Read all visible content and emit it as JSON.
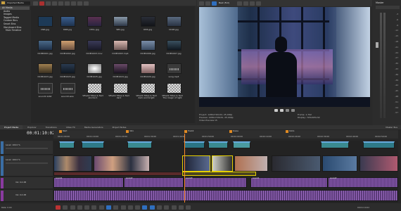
{
  "explorer": {
    "path": "Imported Media",
    "tree": [
      "All Media",
      "Audio",
      "Images",
      "Tagged Media",
      "Custom Bins",
      "Smart Bins",
      "Storyboard Bins",
      "Main Timeline"
    ],
    "row1": [
      {
        "label": "CNR.jpg",
        "color": "#1d3a57"
      },
      {
        "label": "DRB.jpg",
        "color": "#253c5e"
      },
      {
        "label": "DTCL.jpg",
        "color": "#3d3048"
      },
      {
        "label": "SBS.jpg",
        "color": "#4a5565"
      },
      {
        "label": "OMS.jpg",
        "color": "#222630"
      },
      {
        "label": "DCIM.jpg",
        "color": "#3b4759"
      }
    ],
    "row2": [
      {
        "label": "DCIM0001.jpg",
        "color": "#2f4a69"
      },
      {
        "label": "DCIM1002.jpg",
        "color": "#a38060"
      },
      {
        "label": "DCIM1003.mov",
        "color": "#2d2f40"
      },
      {
        "label": "DCIM1063.mp4",
        "color": "#a48d87"
      },
      {
        "label": "DCIM1006.jpg",
        "color": "#4b5c70"
      },
      {
        "label": "DCIM1007.jpg",
        "color": "#1e2e3d"
      }
    ],
    "row3": [
      {
        "label": "DCIM1023.jpg",
        "color": "#6a5a40"
      },
      {
        "label": "DCIM1023.jpg",
        "color": "#1f2d3a"
      },
      {
        "label": "DCIM1025.jpg",
        "color": "#cfcfcf"
      },
      {
        "label": "DCIM1024.jpg",
        "color": "#3b2f40"
      },
      {
        "label": "DCIM1029.jpg",
        "color": "#c2a2a0"
      },
      {
        "label": "song.mp3",
        "color": "#3a3a3a"
      }
    ],
    "row4": [
      {
        "label": "sound1.SAW"
      },
      {
        "label": "sound2.wav"
      },
      {
        "label": "VEGAS Titles & Text alnchor1"
      },
      {
        "label": "VEGAS Titles & Text dark"
      },
      {
        "label": "VEGAS Titles & Text dark and bright"
      },
      {
        "label": "VEGAS Titles & Text The magic of light"
      }
    ]
  },
  "tabs_left": [
    "Project Media",
    "Explorer",
    "Transitions",
    "Video FX",
    "Media Generators",
    "Project Notes"
  ],
  "preview": {
    "mode": "Best (Full)",
    "info": {
      "project_label": "Project:",
      "project": "1280x720x32, 25.000p",
      "preview_label": "Preview:",
      "preview_val": "1280x720x32, 25.000p",
      "display_label": "Video Preview",
      "display": "15",
      "frame_label": "Frame:",
      "frame": "1,702",
      "disp_label": "Display:",
      "disp": "720x405x32"
    }
  },
  "master": {
    "title": "Master",
    "levels": [
      "-3",
      "-6",
      "-9",
      "-12",
      "-15",
      "-18",
      "-21",
      "-24",
      "-27",
      "-30",
      "-33",
      "-36",
      "-39",
      "-42",
      "-45",
      "-48",
      "-51",
      "-54",
      "-57"
    ],
    "bus_tab": "Master Bus"
  },
  "timeline": {
    "timecode": "00:01:10:02",
    "ruler": [
      "00:01:00:00",
      "00:01:10:00",
      "00:01:20:00",
      "00:01:30:00",
      "00:01:40:00",
      "00:01:50:00",
      "00:02:00:00",
      "00:02:10:00",
      "00:02:20:00",
      "00:02:30:00",
      "00:02:40:00",
      "00:02:50:00"
    ],
    "markers": [
      "Start",
      "Intro",
      "Track2",
      "Scene",
      "Outro"
    ],
    "tracks": [
      {
        "name": "Level: 100.0 %",
        "kind": "video"
      },
      {
        "name": "Level: 100.0 %",
        "kind": "video"
      },
      {
        "name": "Vol: 0.0 dB",
        "kind": "audio"
      },
      {
        "name": "Vol: 0.0 dB",
        "kind": "audio"
      }
    ],
    "audio_labels": [
      "sound1",
      "sound2",
      "sound3",
      "sound1",
      "sound2"
    ],
    "rate_label": "Rate: 0.00",
    "footer_time": "00:01:10:02"
  }
}
